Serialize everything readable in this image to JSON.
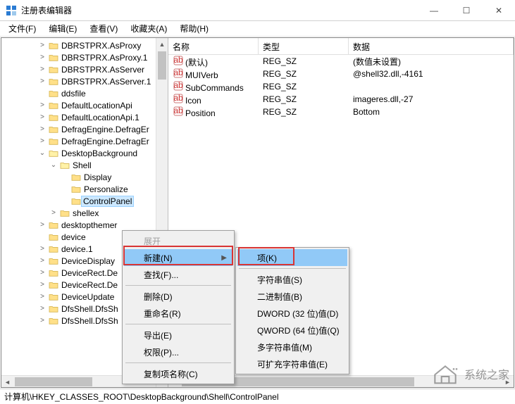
{
  "window": {
    "title": "注册表编辑器"
  },
  "win_controls": {
    "min": "—",
    "max": "☐",
    "close": "✕"
  },
  "menubar": [
    "文件(F)",
    "编辑(E)",
    "查看(V)",
    "收藏夹(A)",
    "帮助(H)"
  ],
  "tree": [
    {
      "d": 3,
      "e": ">",
      "t": "DBRSTPRX.AsProxy"
    },
    {
      "d": 3,
      "e": ">",
      "t": "DBRSTPRX.AsProxy.1"
    },
    {
      "d": 3,
      "e": ">",
      "t": "DBRSTPRX.AsServer"
    },
    {
      "d": 3,
      "e": ">",
      "t": "DBRSTPRX.AsServer.1"
    },
    {
      "d": 3,
      "e": "",
      "t": "ddsfile"
    },
    {
      "d": 3,
      "e": ">",
      "t": "DefaultLocationApi"
    },
    {
      "d": 3,
      "e": ">",
      "t": "DefaultLocationApi.1"
    },
    {
      "d": 3,
      "e": ">",
      "t": "DefragEngine.DefragEr"
    },
    {
      "d": 3,
      "e": ">",
      "t": "DefragEngine.DefragEr"
    },
    {
      "d": 3,
      "e": "v",
      "t": "DesktopBackground",
      "open": true
    },
    {
      "d": 4,
      "e": "v",
      "t": "Shell",
      "open": true
    },
    {
      "d": 5,
      "e": "",
      "t": "Display"
    },
    {
      "d": 5,
      "e": "",
      "t": "Personalize"
    },
    {
      "d": 5,
      "e": "",
      "t": "ControlPanel",
      "sel": true
    },
    {
      "d": 4,
      "e": ">",
      "t": "shellex"
    },
    {
      "d": 3,
      "e": ">",
      "t": "desktopthemer"
    },
    {
      "d": 3,
      "e": "",
      "t": "device"
    },
    {
      "d": 3,
      "e": ">",
      "t": "device.1"
    },
    {
      "d": 3,
      "e": ">",
      "t": "DeviceDisplay"
    },
    {
      "d": 3,
      "e": ">",
      "t": "DeviceRect.De"
    },
    {
      "d": 3,
      "e": ">",
      "t": "DeviceRect.De"
    },
    {
      "d": 3,
      "e": ">",
      "t": "DeviceUpdate"
    },
    {
      "d": 3,
      "e": ">",
      "t": "DfsShell.DfsSh"
    },
    {
      "d": 3,
      "e": ">",
      "t": "DfsShell.DfsSh"
    }
  ],
  "list": {
    "headers": {
      "name": "名称",
      "type": "类型",
      "data": "数据"
    },
    "rows": [
      {
        "name": "(默认)",
        "type": "REG_SZ",
        "data": "(数值未设置)"
      },
      {
        "name": "MUIVerb",
        "type": "REG_SZ",
        "data": "@shell32.dll,-4161"
      },
      {
        "name": "SubCommands",
        "type": "REG_SZ",
        "data": ""
      },
      {
        "name": "Icon",
        "type": "REG_SZ",
        "data": "imageres.dll,-27"
      },
      {
        "name": "Position",
        "type": "REG_SZ",
        "data": "Bottom"
      }
    ]
  },
  "ctx1": {
    "expand": "展开",
    "new": "新建(N)",
    "find": "查找(F)...",
    "delete": "删除(D)",
    "rename": "重命名(R)",
    "export": "导出(E)",
    "perm": "权限(P)...",
    "copykey": "复制项名称(C)"
  },
  "ctx2": {
    "key": "项(K)",
    "string": "字符串值(S)",
    "binary": "二进制值(B)",
    "dword": "DWORD (32 位)值(D)",
    "qword": "QWORD (64 位)值(Q)",
    "multi": "多字符串值(M)",
    "expand": "可扩充字符串值(E)"
  },
  "status": "计算机\\HKEY_CLASSES_ROOT\\DesktopBackground\\Shell\\ControlPanel",
  "watermark": "系统之家"
}
